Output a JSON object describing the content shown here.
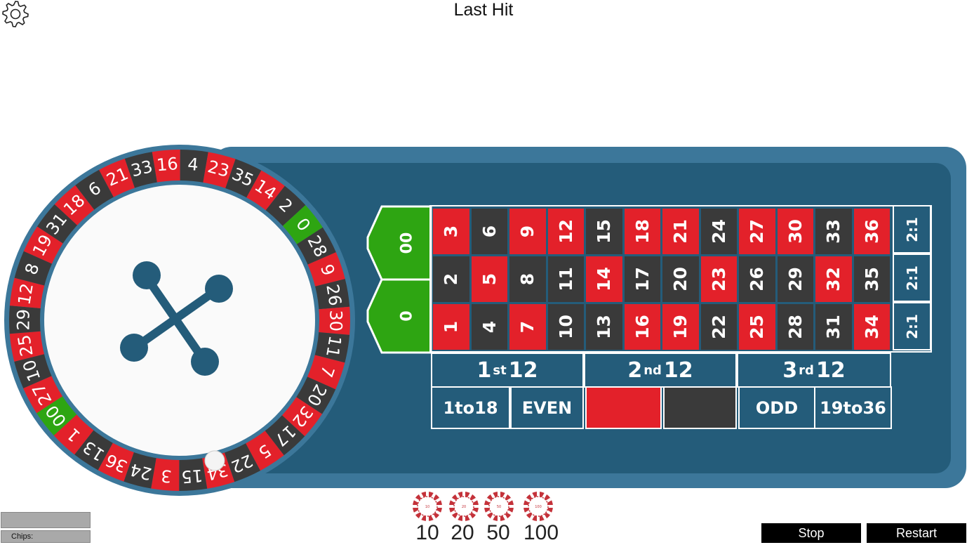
{
  "header": {
    "title": "Last Hit",
    "settings_icon": "gear-icon"
  },
  "wheel": {
    "numbers": [
      "21",
      "33",
      "16",
      "4",
      "23",
      "35",
      "14",
      "2",
      "0",
      "28",
      "9",
      "26",
      "30",
      "11",
      "7",
      "20",
      "32",
      "17",
      "5",
      "22",
      "34",
      "15",
      "3",
      "24",
      "36",
      "13",
      "1",
      "00",
      "27",
      "10",
      "25",
      "29",
      "12",
      "8",
      "19",
      "31",
      "18",
      "6"
    ],
    "colors": {
      "red": "#e3212a",
      "black": "#3a3a3a",
      "green": "#2ea512"
    },
    "green_numbers": [
      "0",
      "00"
    ],
    "ball_on": "34",
    "hub_icon": "turret-cross-icon"
  },
  "board": {
    "zeros": [
      "00",
      "0"
    ],
    "columns": [
      [
        "3",
        "2",
        "1"
      ],
      [
        "6",
        "5",
        "4"
      ],
      [
        "9",
        "8",
        "7"
      ],
      [
        "12",
        "11",
        "10"
      ],
      [
        "15",
        "14",
        "13"
      ],
      [
        "18",
        "17",
        "16"
      ],
      [
        "21",
        "20",
        "19"
      ],
      [
        "24",
        "23",
        "22"
      ],
      [
        "27",
        "26",
        "25"
      ],
      [
        "30",
        "29",
        "28"
      ],
      [
        "33",
        "32",
        "31"
      ],
      [
        "36",
        "35",
        "34"
      ]
    ],
    "red_numbers": [
      "1",
      "3",
      "5",
      "7",
      "9",
      "12",
      "14",
      "16",
      "18",
      "19",
      "21",
      "23",
      "25",
      "27",
      "30",
      "32",
      "34",
      "36"
    ],
    "column_bets": [
      "2:1",
      "2:1",
      "2:1"
    ],
    "dozens": [
      {
        "ordinal": "1",
        "suffix": "st",
        "label": "12"
      },
      {
        "ordinal": "2",
        "suffix": "nd",
        "label": "12"
      },
      {
        "ordinal": "3",
        "suffix": "rd",
        "label": "12"
      }
    ],
    "outside": {
      "low": "1to18",
      "even": "EVEN",
      "odd": "ODD",
      "high": "19to36"
    }
  },
  "chips": {
    "values": [
      "10",
      "20",
      "50",
      "100"
    ],
    "icon": "casino-chip-icon"
  },
  "status": {
    "chips_label": "Chips:"
  },
  "buttons": {
    "stop": "Stop",
    "restart": "Restart"
  }
}
